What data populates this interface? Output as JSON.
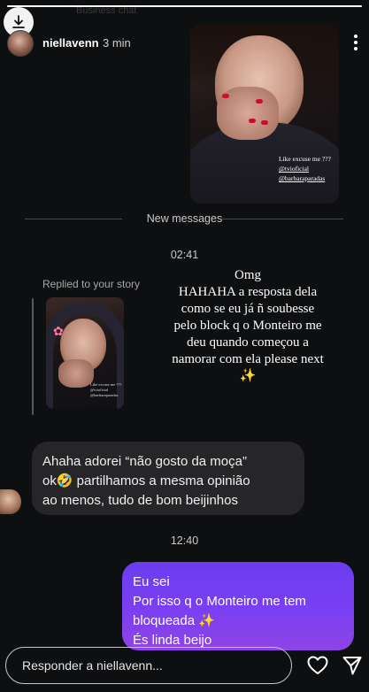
{
  "story": {
    "username": "niellavenn",
    "time": "3 min",
    "ghost_sub": "Business chat",
    "progress_pct": 100
  },
  "story_photo": {
    "caption_line1": "Like excuse me ???",
    "caption_mention1": "@tvioficial",
    "caption_mention2": "@barbaraparadas"
  },
  "chat": {
    "new_messages_label": "New messages",
    "time_1": "02:41",
    "replied_label": "Replied to your story",
    "thumb_caption_line1": "Like excuse me ???",
    "thumb_caption_line2": "@tvioficial",
    "thumb_caption_line3": "@barbaraparadas",
    "thumb_flower": "✿",
    "overlay_text": "Omg\nHAHAHA a resposta dela\ncomo se eu já ñ soubesse\npelo block q o Monteiro me\ndeu quando começou a\nnamorar com ela please next\n✨",
    "incoming_message": "Ahaha adorei “não gosto da moça”\nok🤣 partilhamos a mesma opinião\nao menos, tudo de bom beijinhos",
    "time_2": "12:40",
    "outgoing_message": "Eu sei\nPor isso q o Monteiro me tem\nbloqueada ✨\nÉs linda beijo"
  },
  "composer": {
    "placeholder": "Responder a niellavenn..."
  },
  "icons": {
    "download": "download-icon",
    "play": "play-icon",
    "more": "more-icon",
    "heart": "heart-icon",
    "send": "send-icon"
  },
  "colors": {
    "background": "#0e0f11",
    "incoming_bubble": "#262629",
    "outgoing_bubble_start": "#6a3df0",
    "outgoing_bubble_end": "#8e44e6",
    "nail_polish": "#c8102e"
  }
}
